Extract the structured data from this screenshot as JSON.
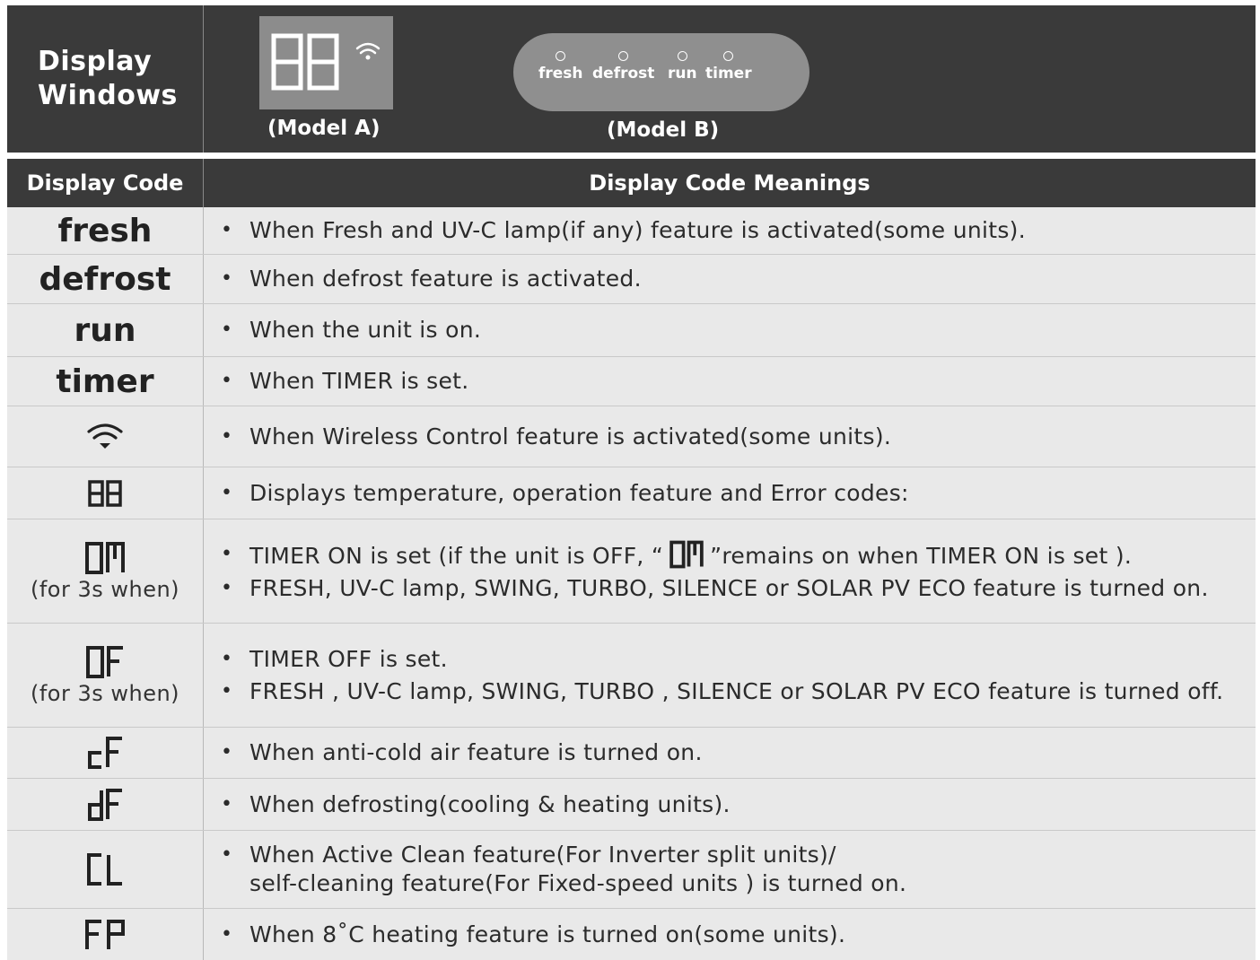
{
  "header": {
    "label_line1": "Display",
    "label_line2": "Windows",
    "model_a_caption": "(Model A)",
    "model_b_caption": "(Model B)",
    "model_a_digits": "88",
    "model_b_items": [
      "fresh",
      "defrost",
      "run",
      "timer"
    ]
  },
  "columns": {
    "code": "Display Code",
    "meaning": "Display Code Meanings"
  },
  "rows": [
    {
      "code": "fresh",
      "meanings": [
        "When Fresh and UV-C lamp(if any) feature is activated(some units)."
      ]
    },
    {
      "code": "defrost",
      "meanings": [
        "When defrost feature is activated."
      ]
    },
    {
      "code": "run",
      "meanings": [
        "When the unit is on."
      ]
    },
    {
      "code": "timer",
      "meanings": [
        "When TIMER is set."
      ]
    },
    {
      "code_icon": "wifi-icon",
      "meanings": [
        "When Wireless Control feature is activated(some units)."
      ]
    },
    {
      "code_icon": "segment-88",
      "meanings": [
        "Displays  temperature, operation feature and Error codes:"
      ]
    },
    {
      "code_icon": "segment-on",
      "note": "(for 3s when)",
      "meanings_a_pre": "TIMER ON is set (if the unit is OFF, “",
      "meanings_a_post": "”remains on when TIMER ON is set ).",
      "meanings": [
        "FRESH, UV-C lamp, SWING, TURBO, SILENCE or SOLAR PV ECO feature is turned on."
      ]
    },
    {
      "code_icon": "segment-of",
      "note": "(for 3s when)",
      "meanings": [
        "TIMER OFF is set.",
        "FRESH , UV-C lamp, SWING, TURBO , SILENCE  or SOLAR PV ECO  feature is turned off."
      ]
    },
    {
      "code_icon": "segment-cf",
      "meanings": [
        "When anti-cold air feature is turned on."
      ]
    },
    {
      "code_icon": "segment-df",
      "meanings": [
        "When defrosting(cooling & heating units)."
      ]
    },
    {
      "code_icon": "segment-cl",
      "meanings": [
        "When Active Clean feature(For Inverter split units)/",
        "self-cleaning feature(For Fixed-speed units ) is turned on."
      ]
    },
    {
      "code_icon": "segment-fp",
      "meanings": [
        "When 8˚C heating feature is turned on(some units)."
      ]
    }
  ],
  "colors": {
    "dark": "#3a3a3a",
    "row_bg": "#e9e9e9",
    "panel": "#8c8c8c"
  }
}
